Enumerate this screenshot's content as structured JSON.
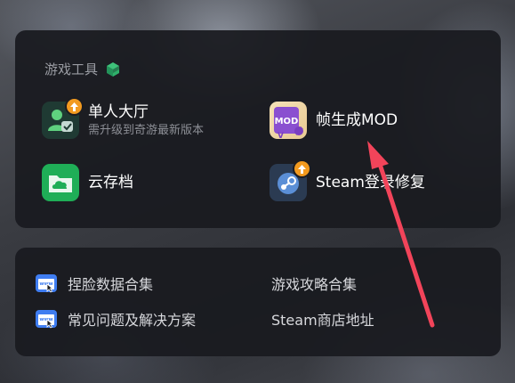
{
  "tools_section": {
    "title": "游戏工具",
    "title_icon": "cube-icon",
    "tools": [
      {
        "name": "单人大厅",
        "sub": "需升级到奇游最新版本",
        "icon": "single-player-icon",
        "badge": "upgrade-badge"
      },
      {
        "name": "帧生成MOD",
        "icon": "mod-icon",
        "badge": "upgrade-badge"
      },
      {
        "name": "云存档",
        "icon": "cloud-save-icon"
      },
      {
        "name": "Steam登录修复",
        "icon": "steam-icon",
        "badge": "upgrade-badge"
      }
    ]
  },
  "links_section": {
    "links": [
      {
        "label": "捏脸数据合集",
        "icon": "www-icon"
      },
      {
        "label": "游戏攻略合集"
      },
      {
        "label": "常见问题及解决方案",
        "icon": "www-icon"
      },
      {
        "label": "Steam商店地址"
      }
    ]
  },
  "colors": {
    "panel": "#1a1b20",
    "badge": "#f29a1f",
    "cloud": "#1fae57",
    "mod": "#8a4fd0",
    "arrow": "#f2445a"
  }
}
